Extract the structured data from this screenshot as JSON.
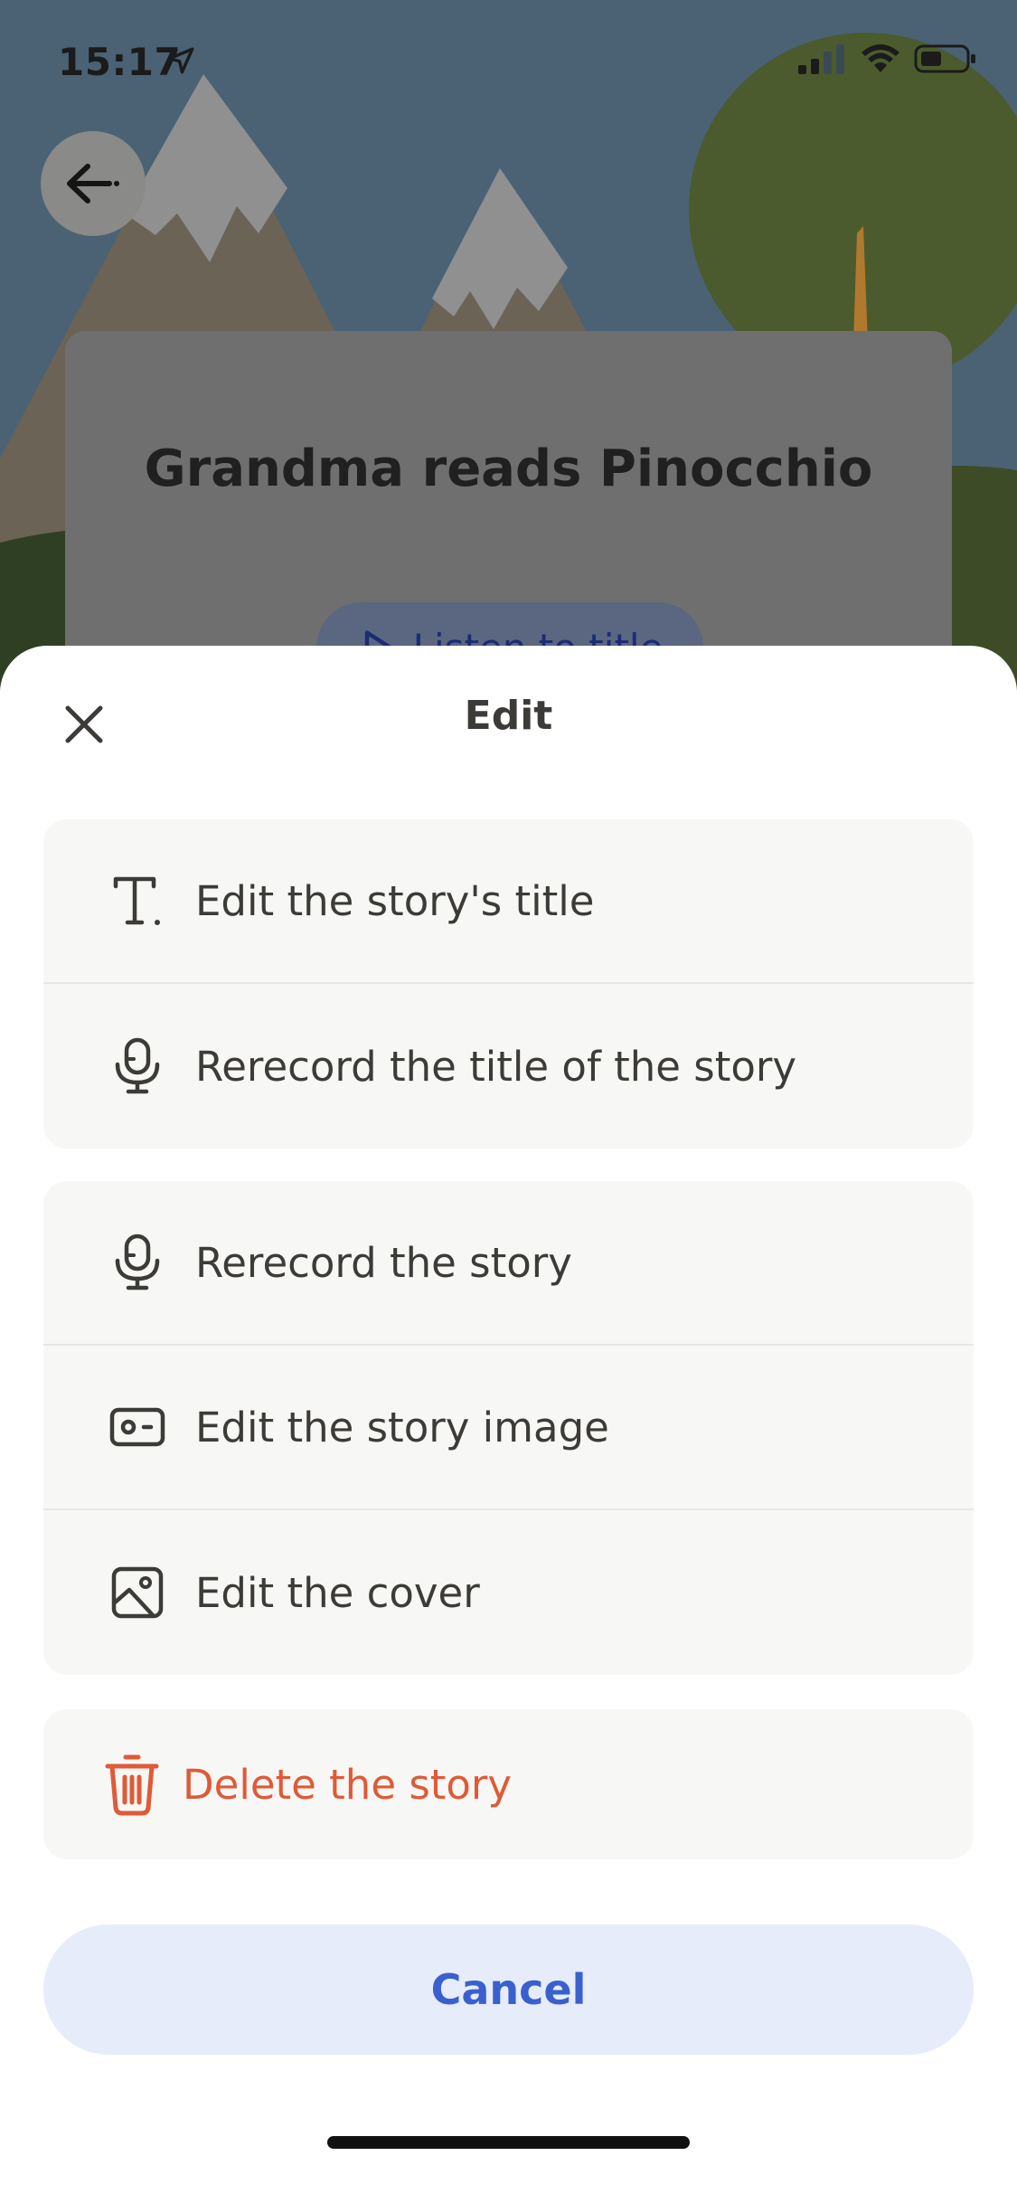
{
  "status_bar": {
    "time": "15:17"
  },
  "background": {
    "story_title": "Grandma reads Pinocchio",
    "listen_label": "Listen to title"
  },
  "sheet": {
    "title": "Edit",
    "groups": [
      {
        "items": [
          {
            "label": "Edit the story's title",
            "icon": "text-icon"
          },
          {
            "label": "Rerecord the title of the story",
            "icon": "microphone-icon"
          }
        ]
      },
      {
        "items": [
          {
            "label": "Rerecord the story",
            "icon": "microphone-icon"
          },
          {
            "label": "Edit the story image",
            "icon": "photo-card-icon"
          },
          {
            "label": "Edit the cover",
            "icon": "image-icon"
          }
        ]
      },
      {
        "items": [
          {
            "label": "Delete the story",
            "icon": "trash-icon"
          }
        ]
      }
    ],
    "cancel_label": "Cancel"
  },
  "colors": {
    "text": "#3d3b37",
    "danger": "#df5a37",
    "accent": "#3a5fcf",
    "row_background": "#f7f7f5",
    "cancel_background": "#e7ecfb"
  }
}
